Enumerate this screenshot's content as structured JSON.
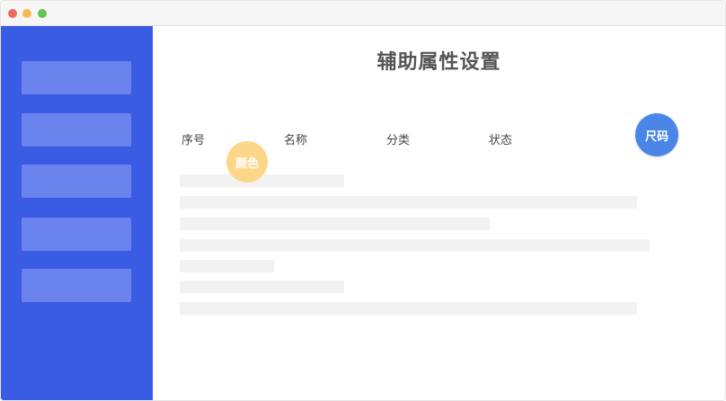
{
  "window": {
    "title_bar": {
      "buttons": [
        "close",
        "minimize",
        "maximize"
      ]
    }
  },
  "sidebar": {
    "items": [
      {
        "label": ""
      },
      {
        "label": ""
      },
      {
        "label": ""
      },
      {
        "label": ""
      },
      {
        "label": ""
      }
    ]
  },
  "main": {
    "title": "辅助属性设置",
    "columns": [
      "序号",
      "名称",
      "分类",
      "状态"
    ],
    "badges": {
      "color_label": "颜色",
      "size_label": "尺码"
    }
  },
  "colors": {
    "sidebar": "#3a5be3",
    "sidebar_item": "#6b83ec",
    "badge_color": "#fdd68a",
    "badge_size": "#4a86e8",
    "placeholder": "#f2f2f2"
  }
}
